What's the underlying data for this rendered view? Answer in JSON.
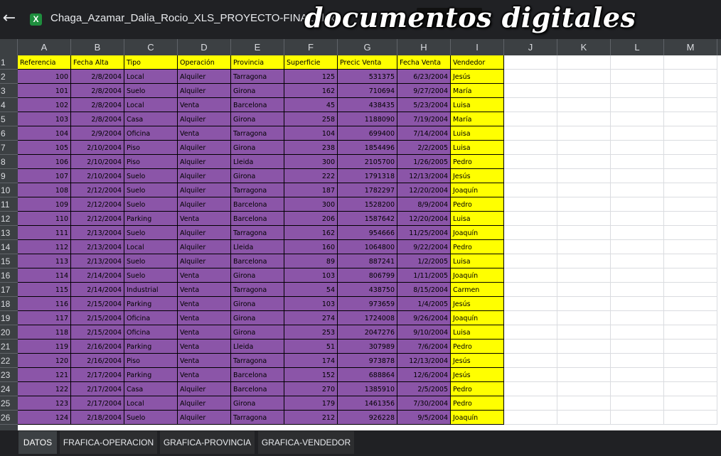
{
  "toolbar": {
    "filename": "Chaga_Azamar_Dalia_Rocio_XLS_PROYECTO-FINAL.xlsx",
    "file_icon_letter": "X",
    "watermark": "documentos digitales"
  },
  "columns": [
    "A",
    "B",
    "C",
    "D",
    "E",
    "F",
    "G",
    "H",
    "I",
    "J",
    "K",
    "L",
    "M"
  ],
  "row_numbers": [
    "1",
    "2",
    "3",
    "4",
    "5",
    "6",
    "7",
    "8",
    "9",
    "10",
    "11",
    "12",
    "13",
    "14",
    "15",
    "16",
    "17",
    "18",
    "19",
    "20",
    "21",
    "22",
    "23",
    "24",
    "25",
    "26"
  ],
  "headers": [
    "Referencia",
    "Fecha Alta",
    "Tipo",
    "Operación",
    "Provincia",
    "Superficie",
    "Precic Venta",
    "Fecha Venta",
    "Vendedor"
  ],
  "rows": [
    [
      "100",
      "2/8/2004",
      "Local",
      "Alquiler",
      "Tarragona",
      "125",
      "531375",
      "6/23/2004",
      "Jesús"
    ],
    [
      "101",
      "2/8/2004",
      "Suelo",
      "Alquiler",
      "Girona",
      "162",
      "710694",
      "9/27/2004",
      "María"
    ],
    [
      "102",
      "2/8/2004",
      "Local",
      "Venta",
      "Barcelona",
      "45",
      "438435",
      "5/23/2004",
      "Luisa"
    ],
    [
      "103",
      "2/8/2004",
      "Casa",
      "Alquiler",
      "Girona",
      "258",
      "1188090",
      "7/19/2004",
      "María"
    ],
    [
      "104",
      "2/9/2004",
      "Oficina",
      "Venta",
      "Tarragona",
      "104",
      "699400",
      "7/14/2004",
      "Luisa"
    ],
    [
      "105",
      "2/10/2004",
      "Piso",
      "Alquiler",
      "Girona",
      "238",
      "1854496",
      "2/2/2005",
      "Luisa"
    ],
    [
      "106",
      "2/10/2004",
      "Piso",
      "Alquiler",
      "Lleida",
      "300",
      "2105700",
      "1/26/2005",
      "Pedro"
    ],
    [
      "107",
      "2/10/2004",
      "Suelo",
      "Alquiler",
      "Girona",
      "222",
      "1791318",
      "12/13/2004",
      "Jesús"
    ],
    [
      "108",
      "2/12/2004",
      "Suelo",
      "Alquiler",
      "Tarragona",
      "187",
      "1782297",
      "12/20/2004",
      "Joaquín"
    ],
    [
      "109",
      "2/12/2004",
      "Suelo",
      "Alquiler",
      "Barcelona",
      "300",
      "1528200",
      "8/9/2004",
      "Pedro"
    ],
    [
      "110",
      "2/12/2004",
      "Parking",
      "Venta",
      "Barcelona",
      "206",
      "1587642",
      "12/20/2004",
      "Luisa"
    ],
    [
      "111",
      "2/13/2004",
      "Suelo",
      "Alquiler",
      "Tarragona",
      "162",
      "954666",
      "11/25/2004",
      "Joaquín"
    ],
    [
      "112",
      "2/13/2004",
      "Local",
      "Alquiler",
      "Lleida",
      "160",
      "1064800",
      "9/22/2004",
      "Pedro"
    ],
    [
      "113",
      "2/13/2004",
      "Suelo",
      "Alquiler",
      "Barcelona",
      "89",
      "887241",
      "1/2/2005",
      "Luisa"
    ],
    [
      "114",
      "2/14/2004",
      "Suelo",
      "Venta",
      "Girona",
      "103",
      "806799",
      "1/11/2005",
      "Joaquín"
    ],
    [
      "115",
      "2/14/2004",
      "Industrial",
      "Venta",
      "Tarragona",
      "54",
      "438750",
      "8/15/2004",
      "Carmen"
    ],
    [
      "116",
      "2/15/2004",
      "Parking",
      "Venta",
      "Girona",
      "103",
      "973659",
      "1/4/2005",
      "Jesús"
    ],
    [
      "117",
      "2/15/2004",
      "Oficina",
      "Venta",
      "Girona",
      "274",
      "1724008",
      "9/26/2004",
      "Joaquín"
    ],
    [
      "118",
      "2/15/2004",
      "Oficina",
      "Venta",
      "Girona",
      "253",
      "2047276",
      "9/10/2004",
      "Luisa"
    ],
    [
      "119",
      "2/16/2004",
      "Parking",
      "Venta",
      "Lleida",
      "51",
      "307989",
      "7/6/2004",
      "Pedro"
    ],
    [
      "120",
      "2/16/2004",
      "Piso",
      "Venta",
      "Tarragona",
      "174",
      "973878",
      "12/13/2004",
      "Jesús"
    ],
    [
      "121",
      "2/17/2004",
      "Parking",
      "Venta",
      "Barcelona",
      "152",
      "688864",
      "12/6/2004",
      "Jesús"
    ],
    [
      "122",
      "2/17/2004",
      "Casa",
      "Alquiler",
      "Barcelona",
      "270",
      "1385910",
      "2/5/2005",
      "Pedro"
    ],
    [
      "123",
      "2/17/2004",
      "Local",
      "Alquiler",
      "Girona",
      "179",
      "1461356",
      "7/30/2004",
      "Pedro"
    ],
    [
      "124",
      "2/18/2004",
      "Suelo",
      "Alquiler",
      "Tarragona",
      "212",
      "926228",
      "9/5/2004",
      "Joaquín"
    ]
  ],
  "sheet_tabs": [
    "DATOS",
    "FRAFICA-OPERACION",
    "GRAFICA-PROVINCIA",
    "GRAFICA-VENDEDOR"
  ],
  "active_tab": "DATOS",
  "colors": {
    "data_fill": "#8b55a8",
    "highlight": "#ffff00",
    "chrome": "#202124"
  }
}
